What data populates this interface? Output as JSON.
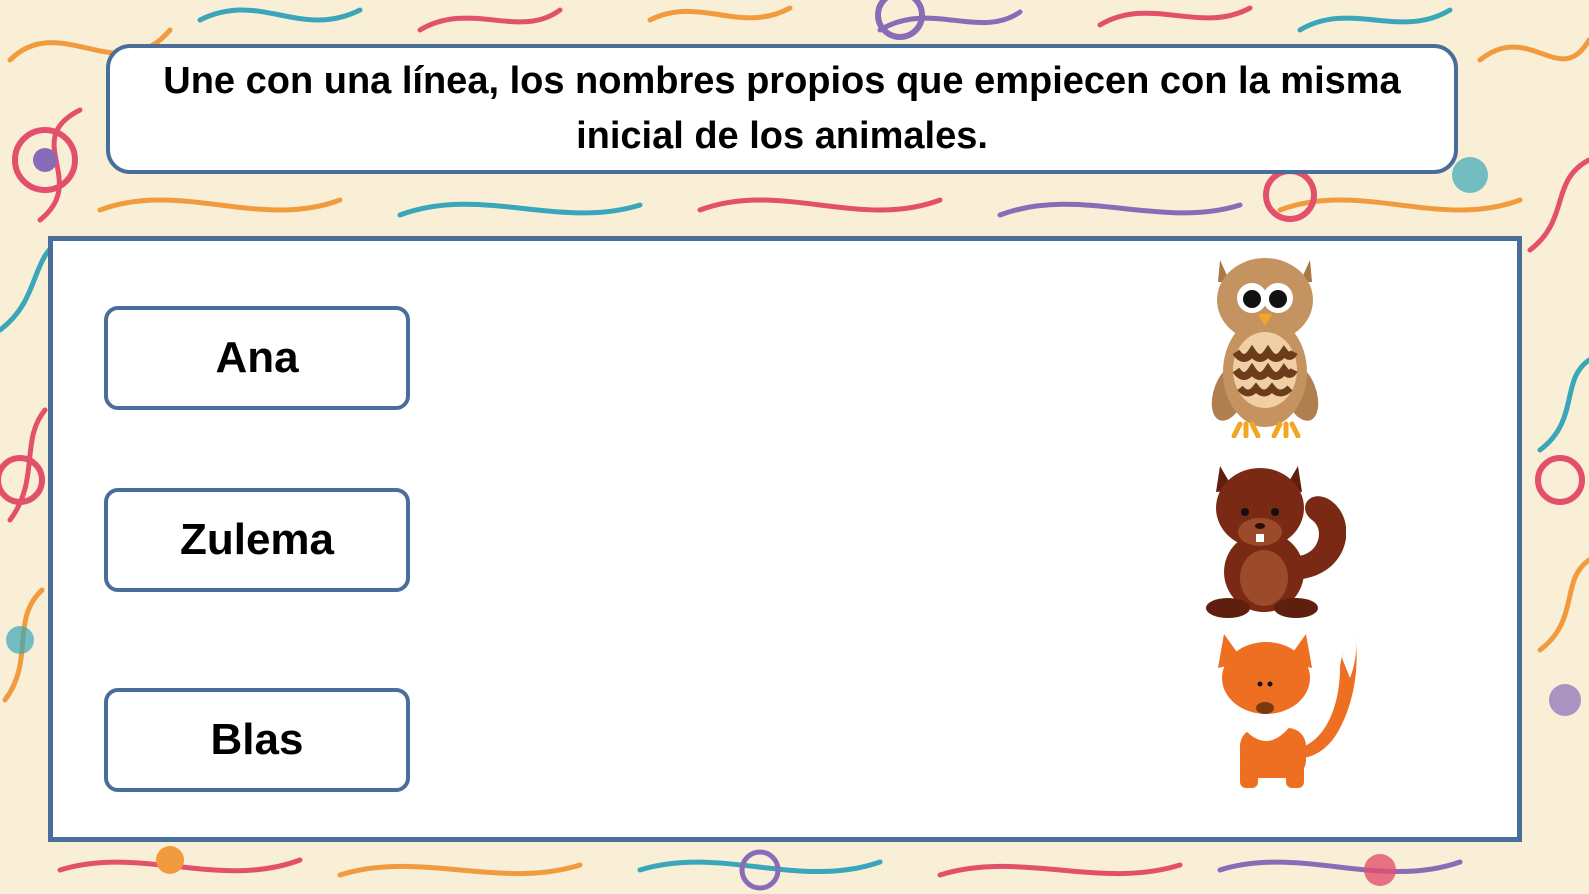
{
  "instruction": "Une con una línea, los nombres propios que empiecen con la misma inicial de los animales.",
  "names": [
    {
      "label": "Ana"
    },
    {
      "label": "Zulema"
    },
    {
      "label": "Blas"
    }
  ],
  "animals": [
    {
      "icon": "owl-icon"
    },
    {
      "icon": "squirrel-icon"
    },
    {
      "icon": "fox-icon"
    }
  ],
  "colors": {
    "border": "#4a6e9a",
    "background": "#f8efd6"
  }
}
